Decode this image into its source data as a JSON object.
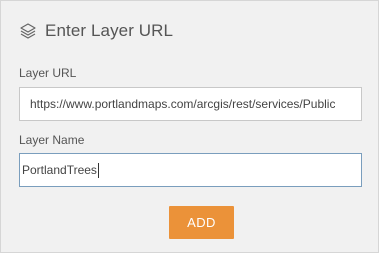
{
  "dialog": {
    "title": "Enter Layer URL",
    "icon": "layers-icon"
  },
  "layer_url": {
    "label": "Layer URL",
    "value": "https://www.portlandmaps.com/arcgis/rest/services/Public"
  },
  "layer_name": {
    "label": "Layer Name",
    "value": "PortlandTrees"
  },
  "actions": {
    "add_label": "ADD"
  },
  "colors": {
    "accent": "#eb9239",
    "panel_bg": "#f1f1f1",
    "focused_border": "#7a9ebd"
  }
}
